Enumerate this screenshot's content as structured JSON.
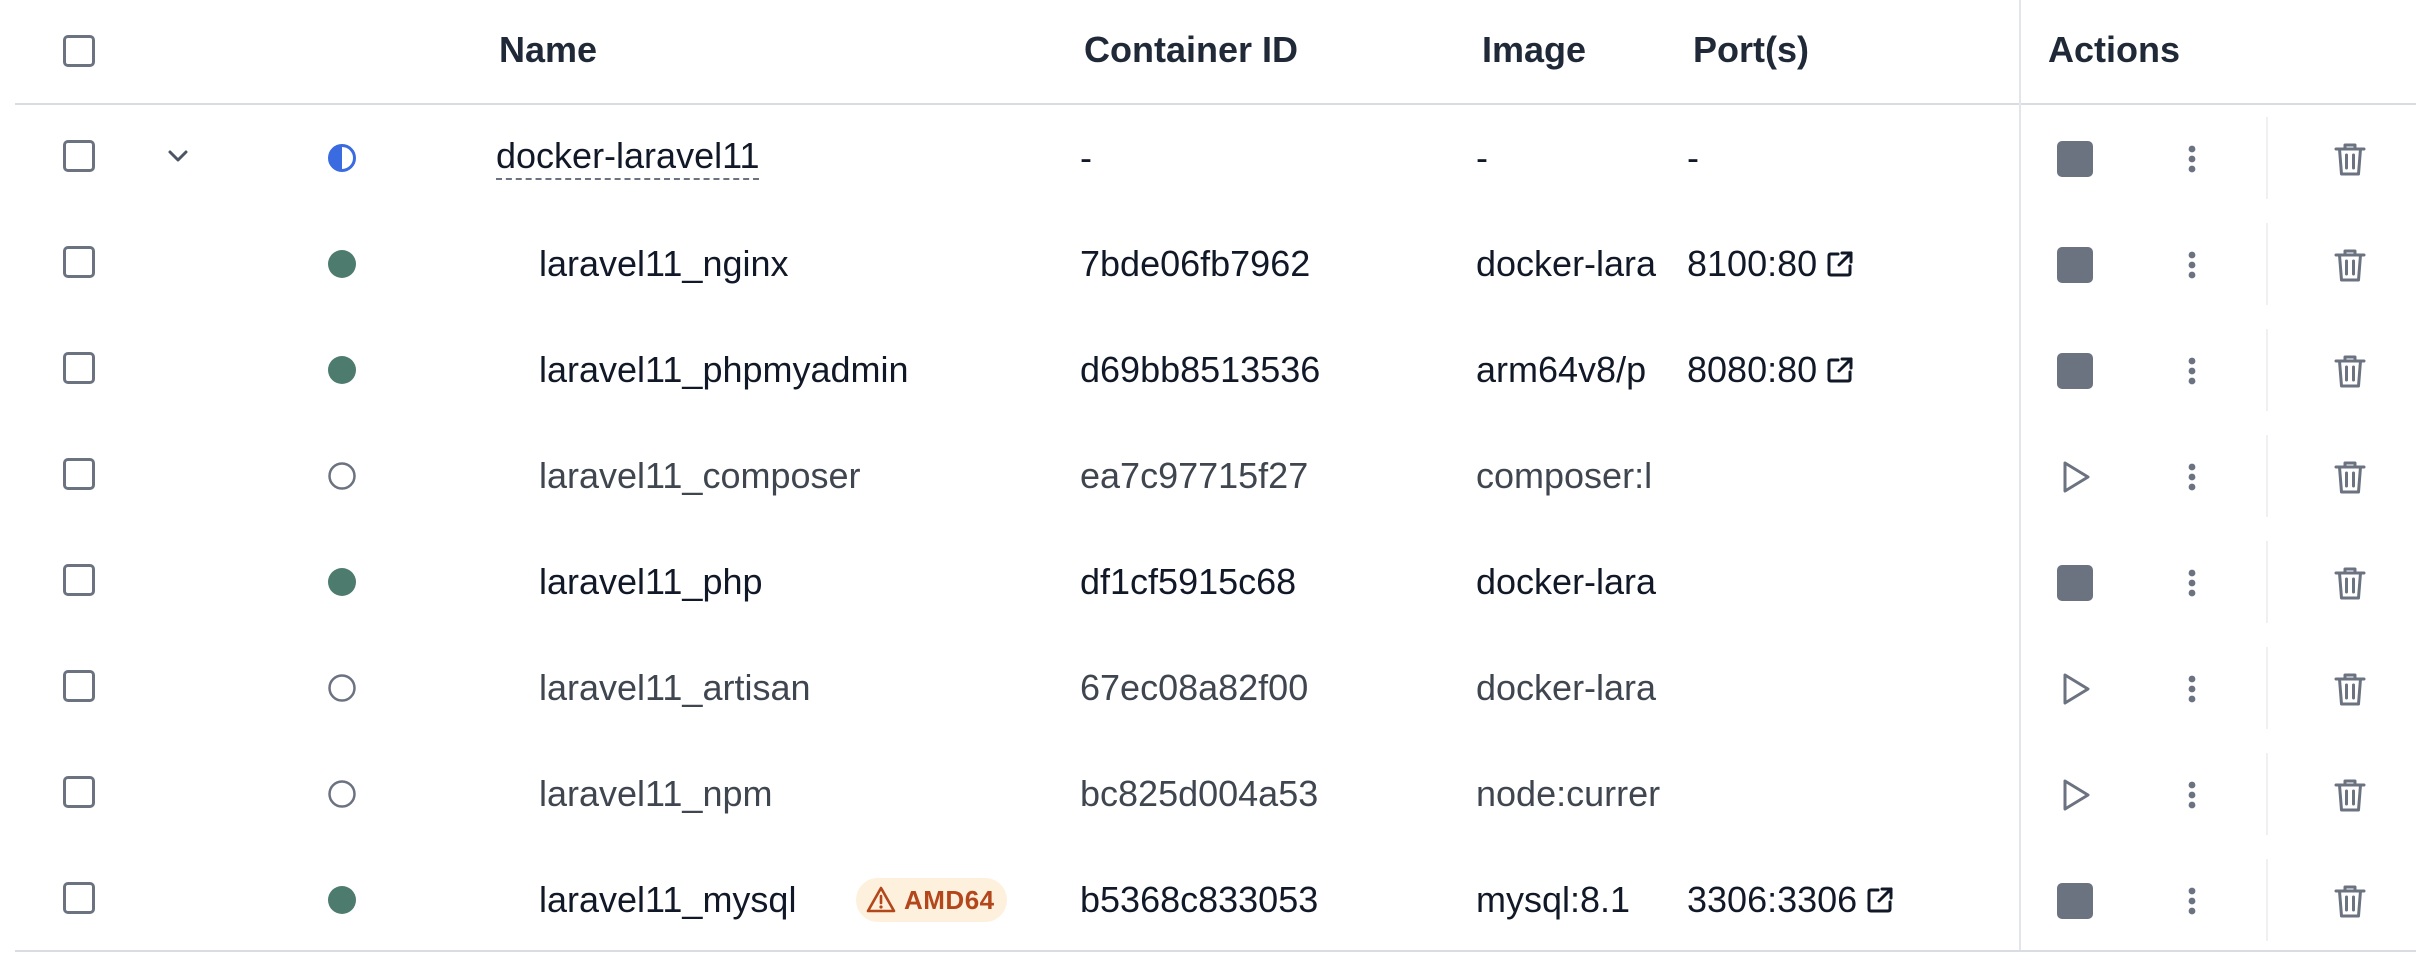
{
  "columns": {
    "name": "Name",
    "container_id": "Container ID",
    "image": "Image",
    "ports": "Port(s)",
    "actions": "Actions"
  },
  "group": {
    "name": "docker-laravel11",
    "container_id": "-",
    "image": "-",
    "ports": "-",
    "status": "partial"
  },
  "containers": [
    {
      "name": "laravel11_nginx",
      "container_id": "7bde06fb7962",
      "image": "docker-lara",
      "ports": "8100:80",
      "status": "running"
    },
    {
      "name": "laravel11_phpmyadmin",
      "container_id": "d69bb8513536",
      "image": "arm64v8/p",
      "ports": "8080:80",
      "status": "running"
    },
    {
      "name": "laravel11_composer",
      "container_id": "ea7c97715f27",
      "image": "composer:l",
      "ports": "",
      "status": "stopped"
    },
    {
      "name": "laravel11_php",
      "container_id": "df1cf5915c68",
      "image": "docker-lara",
      "ports": "",
      "status": "running"
    },
    {
      "name": "laravel11_artisan",
      "container_id": "67ec08a82f00",
      "image": "docker-lara",
      "ports": "",
      "status": "stopped"
    },
    {
      "name": "laravel11_npm",
      "container_id": "bc825d004a53",
      "image": "node:currer",
      "ports": "",
      "status": "stopped"
    },
    {
      "name": "laravel11_mysql",
      "container_id": "b5368c833053",
      "image": "mysql:8.1",
      "ports": "3306:3306",
      "status": "running",
      "badge": "AMD64"
    }
  ],
  "colors": {
    "running": "#4d7c6f",
    "partial": "#3b6be0",
    "stopped_outline": "#6b7280",
    "icon_gray": "#6b7280",
    "badge_bg": "#fdf0dc",
    "badge_text": "#b3471b"
  },
  "icons": {
    "stop": "stop-icon",
    "start": "play-icon",
    "more": "more-vertical-icon",
    "delete": "trash-icon",
    "expand": "chevron-down-icon",
    "external": "external-link-icon",
    "warning": "warning-icon"
  }
}
